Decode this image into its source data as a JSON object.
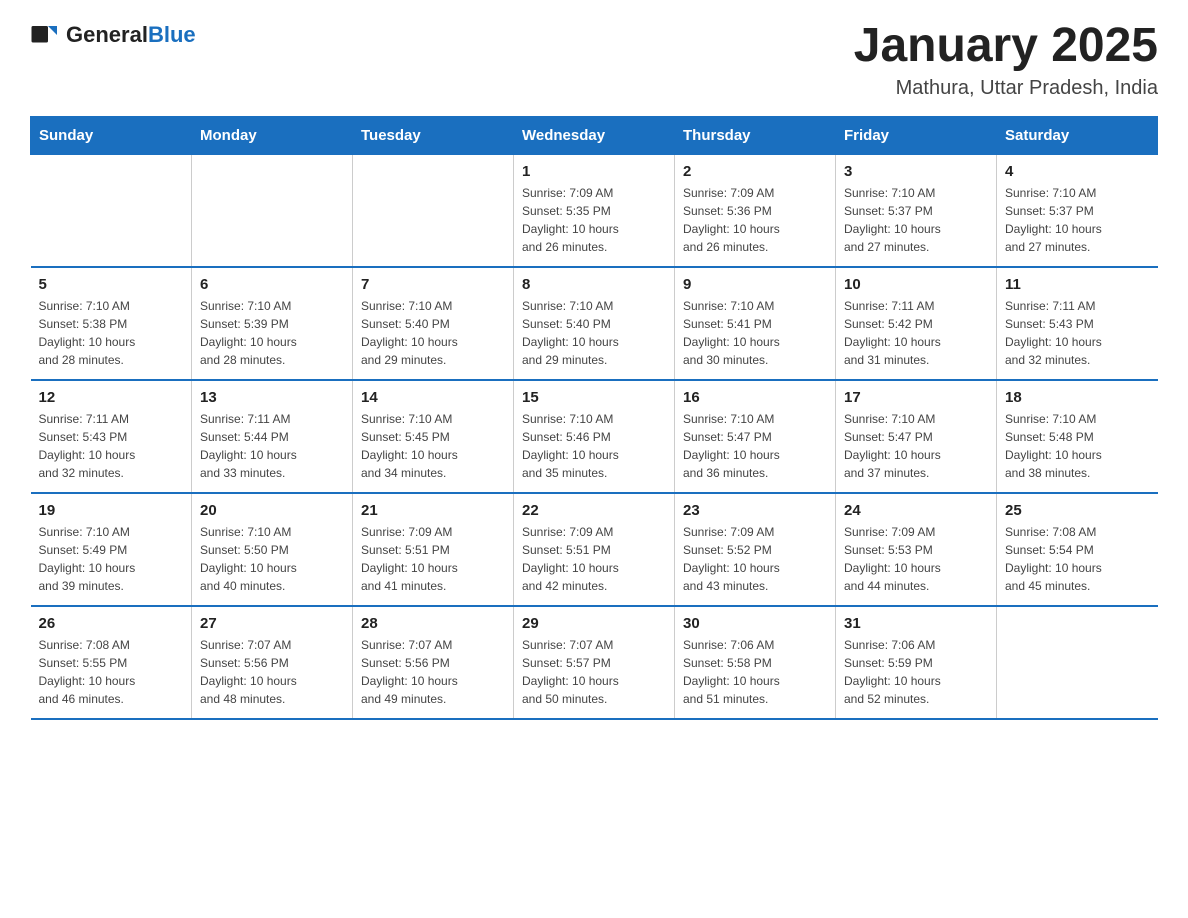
{
  "header": {
    "logo_general": "General",
    "logo_blue": "Blue",
    "month_title": "January 2025",
    "location": "Mathura, Uttar Pradesh, India"
  },
  "weekdays": [
    "Sunday",
    "Monday",
    "Tuesday",
    "Wednesday",
    "Thursday",
    "Friday",
    "Saturday"
  ],
  "weeks": [
    [
      {
        "day": "",
        "info": ""
      },
      {
        "day": "",
        "info": ""
      },
      {
        "day": "",
        "info": ""
      },
      {
        "day": "1",
        "info": "Sunrise: 7:09 AM\nSunset: 5:35 PM\nDaylight: 10 hours\nand 26 minutes."
      },
      {
        "day": "2",
        "info": "Sunrise: 7:09 AM\nSunset: 5:36 PM\nDaylight: 10 hours\nand 26 minutes."
      },
      {
        "day": "3",
        "info": "Sunrise: 7:10 AM\nSunset: 5:37 PM\nDaylight: 10 hours\nand 27 minutes."
      },
      {
        "day": "4",
        "info": "Sunrise: 7:10 AM\nSunset: 5:37 PM\nDaylight: 10 hours\nand 27 minutes."
      }
    ],
    [
      {
        "day": "5",
        "info": "Sunrise: 7:10 AM\nSunset: 5:38 PM\nDaylight: 10 hours\nand 28 minutes."
      },
      {
        "day": "6",
        "info": "Sunrise: 7:10 AM\nSunset: 5:39 PM\nDaylight: 10 hours\nand 28 minutes."
      },
      {
        "day": "7",
        "info": "Sunrise: 7:10 AM\nSunset: 5:40 PM\nDaylight: 10 hours\nand 29 minutes."
      },
      {
        "day": "8",
        "info": "Sunrise: 7:10 AM\nSunset: 5:40 PM\nDaylight: 10 hours\nand 29 minutes."
      },
      {
        "day": "9",
        "info": "Sunrise: 7:10 AM\nSunset: 5:41 PM\nDaylight: 10 hours\nand 30 minutes."
      },
      {
        "day": "10",
        "info": "Sunrise: 7:11 AM\nSunset: 5:42 PM\nDaylight: 10 hours\nand 31 minutes."
      },
      {
        "day": "11",
        "info": "Sunrise: 7:11 AM\nSunset: 5:43 PM\nDaylight: 10 hours\nand 32 minutes."
      }
    ],
    [
      {
        "day": "12",
        "info": "Sunrise: 7:11 AM\nSunset: 5:43 PM\nDaylight: 10 hours\nand 32 minutes."
      },
      {
        "day": "13",
        "info": "Sunrise: 7:11 AM\nSunset: 5:44 PM\nDaylight: 10 hours\nand 33 minutes."
      },
      {
        "day": "14",
        "info": "Sunrise: 7:10 AM\nSunset: 5:45 PM\nDaylight: 10 hours\nand 34 minutes."
      },
      {
        "day": "15",
        "info": "Sunrise: 7:10 AM\nSunset: 5:46 PM\nDaylight: 10 hours\nand 35 minutes."
      },
      {
        "day": "16",
        "info": "Sunrise: 7:10 AM\nSunset: 5:47 PM\nDaylight: 10 hours\nand 36 minutes."
      },
      {
        "day": "17",
        "info": "Sunrise: 7:10 AM\nSunset: 5:47 PM\nDaylight: 10 hours\nand 37 minutes."
      },
      {
        "day": "18",
        "info": "Sunrise: 7:10 AM\nSunset: 5:48 PM\nDaylight: 10 hours\nand 38 minutes."
      }
    ],
    [
      {
        "day": "19",
        "info": "Sunrise: 7:10 AM\nSunset: 5:49 PM\nDaylight: 10 hours\nand 39 minutes."
      },
      {
        "day": "20",
        "info": "Sunrise: 7:10 AM\nSunset: 5:50 PM\nDaylight: 10 hours\nand 40 minutes."
      },
      {
        "day": "21",
        "info": "Sunrise: 7:09 AM\nSunset: 5:51 PM\nDaylight: 10 hours\nand 41 minutes."
      },
      {
        "day": "22",
        "info": "Sunrise: 7:09 AM\nSunset: 5:51 PM\nDaylight: 10 hours\nand 42 minutes."
      },
      {
        "day": "23",
        "info": "Sunrise: 7:09 AM\nSunset: 5:52 PM\nDaylight: 10 hours\nand 43 minutes."
      },
      {
        "day": "24",
        "info": "Sunrise: 7:09 AM\nSunset: 5:53 PM\nDaylight: 10 hours\nand 44 minutes."
      },
      {
        "day": "25",
        "info": "Sunrise: 7:08 AM\nSunset: 5:54 PM\nDaylight: 10 hours\nand 45 minutes."
      }
    ],
    [
      {
        "day": "26",
        "info": "Sunrise: 7:08 AM\nSunset: 5:55 PM\nDaylight: 10 hours\nand 46 minutes."
      },
      {
        "day": "27",
        "info": "Sunrise: 7:07 AM\nSunset: 5:56 PM\nDaylight: 10 hours\nand 48 minutes."
      },
      {
        "day": "28",
        "info": "Sunrise: 7:07 AM\nSunset: 5:56 PM\nDaylight: 10 hours\nand 49 minutes."
      },
      {
        "day": "29",
        "info": "Sunrise: 7:07 AM\nSunset: 5:57 PM\nDaylight: 10 hours\nand 50 minutes."
      },
      {
        "day": "30",
        "info": "Sunrise: 7:06 AM\nSunset: 5:58 PM\nDaylight: 10 hours\nand 51 minutes."
      },
      {
        "day": "31",
        "info": "Sunrise: 7:06 AM\nSunset: 5:59 PM\nDaylight: 10 hours\nand 52 minutes."
      },
      {
        "day": "",
        "info": ""
      }
    ]
  ]
}
